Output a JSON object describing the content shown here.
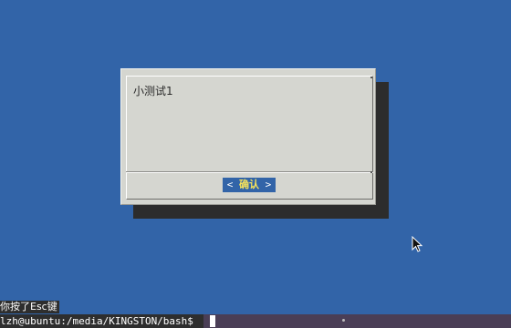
{
  "dialog": {
    "message": "小测试1",
    "ok_button": {
      "prefix": "< ",
      "label": "确认",
      "suffix": " >"
    }
  },
  "terminal": {
    "status_message": "你按了Esc键",
    "prompt": "lzh@ubuntu:/media/KINGSTON/bash$ "
  },
  "colors": {
    "desktop_background": "#3264a8",
    "dialog_background": "#d5d6d0",
    "button_highlight": "#3264a8",
    "button_label": "#f7e35a"
  }
}
